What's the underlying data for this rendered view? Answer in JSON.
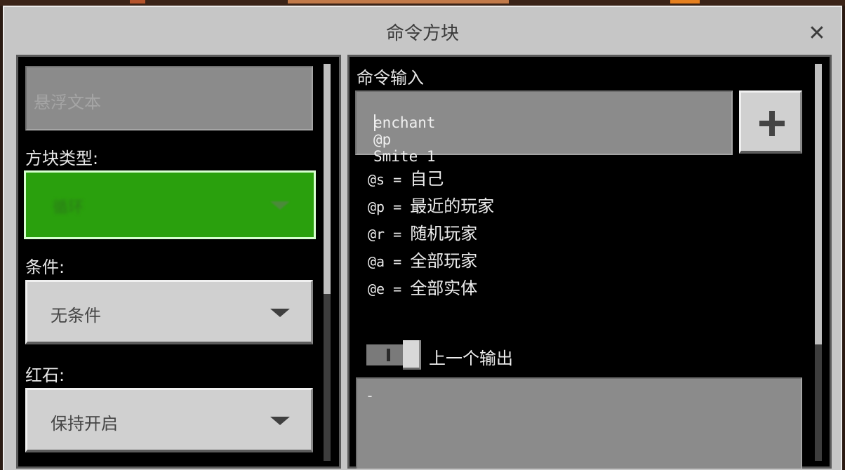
{
  "dialog": {
    "title": "命令方块",
    "close_label": "✕"
  },
  "left": {
    "hover_text_placeholder": "悬浮文本",
    "block_type_label": "方块类型:",
    "block_type_value": "循环",
    "condition_label": "条件:",
    "condition_value": "无条件",
    "redstone_label": "红石:",
    "redstone_value": "保持开启"
  },
  "right": {
    "command_input_label": "命令输入",
    "command_value": "enchant @p Smite 1",
    "add_button_icon": "plus-icon",
    "selectors": [
      {
        "code": "@s",
        "sep": " = ",
        "desc": "自己"
      },
      {
        "code": "@p",
        "sep": " = ",
        "desc": "最近的玩家"
      },
      {
        "code": "@r",
        "sep": " = ",
        "desc": "随机玩家"
      },
      {
        "code": "@a",
        "sep": " = ",
        "desc": "全部玩家"
      },
      {
        "code": "@e",
        "sep": " = ",
        "desc": "全部实体"
      }
    ],
    "previous_output_label": "上一个输出",
    "previous_output_value": "-"
  },
  "colors": {
    "dialog_bg": "#c6c6c6",
    "panel_bg": "#000000",
    "input_bg": "#8b8b8b",
    "block_type_green": "#2aa00d"
  }
}
